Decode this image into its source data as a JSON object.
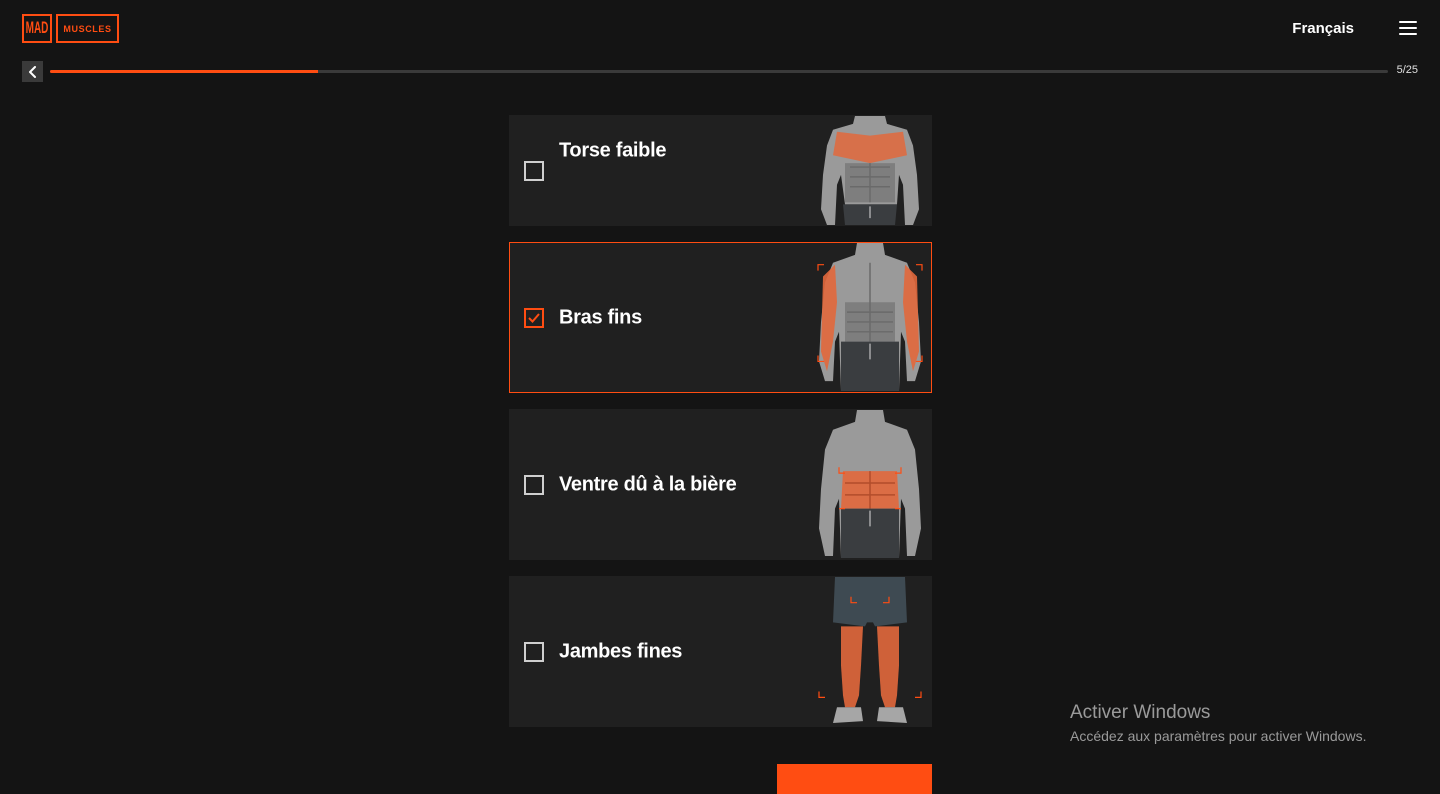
{
  "header": {
    "logo_part1": "MAD",
    "logo_part2": "MUSCLES",
    "language": "Français",
    "menu_icon": "hamburger-icon"
  },
  "progress": {
    "back_icon": "chevron-left-icon",
    "current": 5,
    "total": 25,
    "text": "5/25",
    "fill_fraction": 0.2,
    "accent": "#ff4d12"
  },
  "options": [
    {
      "label": "Torse faible",
      "checked": false,
      "highlight": "chest"
    },
    {
      "label": "Bras fins",
      "checked": true,
      "highlight": "arms"
    },
    {
      "label": "Ventre dû à la bière",
      "checked": false,
      "highlight": "belly"
    },
    {
      "label": "Jambes fines",
      "checked": false,
      "highlight": "legs"
    }
  ],
  "watermark": {
    "title": "Activer Windows",
    "subtitle": "Accédez aux paramètres pour activer Windows."
  },
  "colors": {
    "background": "#141414",
    "card": "#202020",
    "accent": "#ff4d12"
  }
}
